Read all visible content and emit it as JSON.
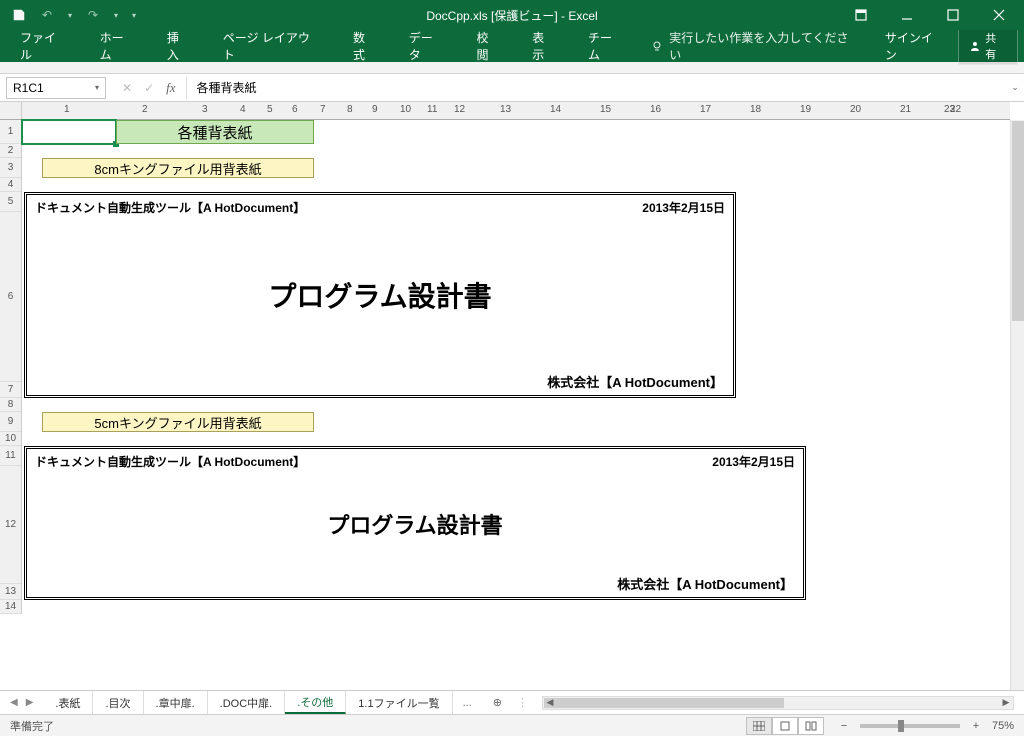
{
  "titlebar": {
    "title": "DocCpp.xls  [保護ビュー] - Excel"
  },
  "ribbon": {
    "tabs": [
      "ファイル",
      "ホーム",
      "挿入",
      "ページ レイアウト",
      "数式",
      "データ",
      "校閲",
      "表示",
      "チーム"
    ],
    "tellme": "実行したい作業を入力してください",
    "signin": "サインイン",
    "share": "共有"
  },
  "namebox": "R1C1",
  "formula": "各種背表紙",
  "ruler_ticks": [
    1,
    2,
    3,
    4,
    5,
    6,
    7,
    8,
    9,
    10,
    11,
    12,
    13,
    14,
    15,
    16,
    17,
    18,
    19,
    20,
    21,
    22,
    23
  ],
  "rows": {
    "heights": [
      24,
      14,
      20,
      14,
      20,
      170,
      16,
      14,
      20,
      14,
      20,
      118,
      16,
      14
    ],
    "labels": [
      "1",
      "2",
      "3",
      "4",
      "5",
      "6",
      "7",
      "8",
      "9",
      "10",
      "11",
      "12",
      "13",
      "14"
    ]
  },
  "cells": {
    "title": "各種背表紙",
    "sub1": "8cmキングファイル用背表紙",
    "sub2": "5cmキングファイル用背表紙"
  },
  "spine1": {
    "tool": "ドキュメント自動生成ツール【A HotDocument】",
    "date": "2013年2月15日",
    "main": "プログラム設計書",
    "company": "株式会社【A HotDocument】"
  },
  "spine2": {
    "tool": "ドキュメント自動生成ツール【A HotDocument】",
    "date": "2013年2月15日",
    "main": "プログラム設計書",
    "company": "株式会社【A HotDocument】"
  },
  "sheets": {
    "tabs": [
      ".表紙",
      ".目次",
      ".章中扉.",
      ".DOC中扉.",
      ".その他",
      "1.1ファイル一覧"
    ],
    "active": 4,
    "more": "..."
  },
  "status": {
    "ready": "準備完了",
    "zoom": "75%"
  }
}
